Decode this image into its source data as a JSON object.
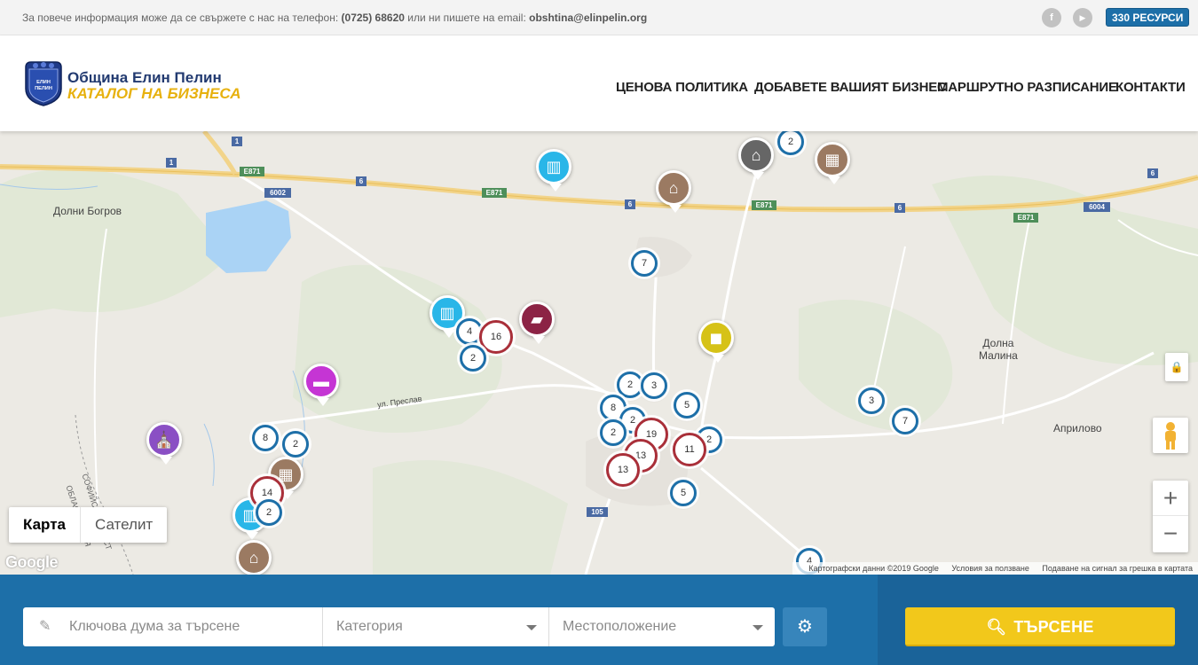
{
  "topbar": {
    "info_text": "За повече информация може да се свържете с нас на телефон:",
    "phone": "(0725) 68620",
    "or_text": "или ни пишете на email:",
    "email": "obshtina@elinpelin.org",
    "facebook_glyph": "f",
    "youtube_glyph": "▶",
    "resources_badge": "330 РЕСУРСИ"
  },
  "header": {
    "logo_title": "Община Елин Пелин",
    "logo_subtitle": "КАТАЛОГ НА БИЗНЕСА",
    "crest_text": "ЕЛИН ПЕЛИН",
    "nav": [
      "ЦЕНОВА ПОЛИТИКА",
      "ДОБАВЕТЕ ВАШИЯТ БИЗНЕС",
      "МАРШРУТНО РАЗПИСАНИЕ",
      "КОНТАКТИ"
    ]
  },
  "map": {
    "places": [
      "Долни Богров",
      "Долна\nМалина",
      "Априлово",
      "ул. Преслав",
      "СОФИЙСКА ОБЛАСТ",
      "ОБЛАСТ СОФИЯ"
    ],
    "road_labels": [
      "1",
      "1",
      "E871",
      "6002",
      "6",
      "E871",
      "6",
      "E871",
      "6",
      "E871",
      "6004",
      "6",
      "105"
    ],
    "clusters": [
      "2",
      "7",
      "4",
      "16",
      "2",
      "2",
      "3",
      "8",
      "2",
      "5",
      "2",
      "19",
      "2",
      "11",
      "13",
      "13",
      "5",
      "3",
      "7",
      "8",
      "2",
      "14",
      "2",
      "4"
    ],
    "pin_colors": {
      "factory": "#29b6e8",
      "warehouse": "#9b7a62",
      "home": "#666666",
      "brick": "#9b7a62",
      "truck": "#8c2345",
      "shopping": "#d6c217",
      "hotel": "#c535d4",
      "church": "#8a4fc4"
    },
    "map_types": [
      "Карта",
      "Сателит"
    ],
    "zoom_in": "+",
    "zoom_out": "−",
    "google_logo": "Google",
    "attribution": [
      "Картографски данни ©2019 Google",
      "Условия за ползване",
      "Подаване на сигнал за грешка в картата"
    ]
  },
  "search": {
    "keyword_placeholder": "Ключова дума за търсене",
    "category_placeholder": "Категория",
    "location_placeholder": "Местоположение",
    "search_button": "ТЪРСЕНЕ",
    "accent_color": "#f2c81b",
    "bar_color": "#1d6fa8"
  }
}
